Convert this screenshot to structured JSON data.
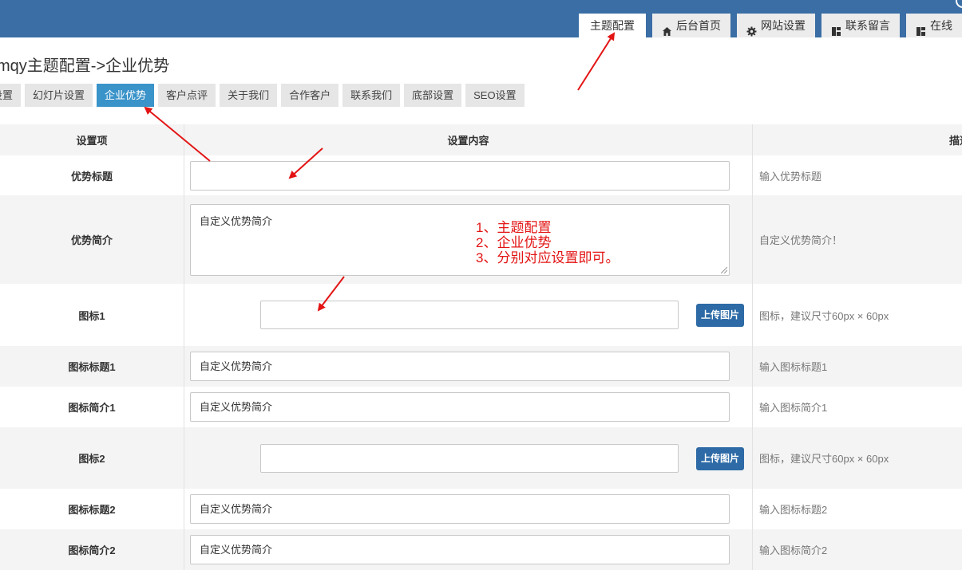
{
  "header": {
    "tabs": [
      {
        "label": "主题配置",
        "icon": ""
      },
      {
        "label": "后台首页",
        "icon": "home-icon"
      },
      {
        "label": "网站设置",
        "icon": "gear-icon"
      },
      {
        "label": "联系留言",
        "icon": "dashboard-icon"
      },
      {
        "label": "在线",
        "icon": "dashboard-icon"
      }
    ]
  },
  "page": {
    "title": "mqy主题配置->企业优势"
  },
  "sub_tabs": [
    "设置",
    "幻灯片设置",
    "企业优势",
    "客户点评",
    "关于我们",
    "合作客户",
    "联系我们",
    "底部设置",
    "SEO设置"
  ],
  "table": {
    "headers": [
      "设置项",
      "设置内容",
      "描述"
    ],
    "rows": [
      {
        "label": "优势标题",
        "value": "",
        "desc": "输入优势标题"
      },
      {
        "label": "优势简介",
        "value": "自定义优势简介",
        "desc": "自定义优势简介！"
      },
      {
        "label": "图标1",
        "value": "",
        "desc": "图标，建议尺寸60px × 60px",
        "button": "上传图片"
      },
      {
        "label": "图标标题1",
        "value": "自定义优势简介",
        "desc": "输入图标标题1"
      },
      {
        "label": "图标简介1",
        "value": "自定义优势简介",
        "desc": "输入图标简介1"
      },
      {
        "label": "图标2",
        "value": "",
        "desc": "图标，建议尺寸60px × 60px",
        "button": "上传图片"
      },
      {
        "label": "图标标题2",
        "value": "自定义优势简介",
        "desc": "输入图标标题2"
      },
      {
        "label": "图标简介2",
        "value": "自定义优势简介",
        "desc": "输入图标简介2"
      }
    ]
  },
  "annotation": {
    "lines": [
      "1、主题配置",
      "2、企业优势",
      "3、分别对应设置即可。"
    ],
    "color": "#e31414"
  },
  "colors": {
    "header": "#3a6ea5",
    "active_tab": "#3a93c9",
    "button": "#2d6aa6"
  }
}
